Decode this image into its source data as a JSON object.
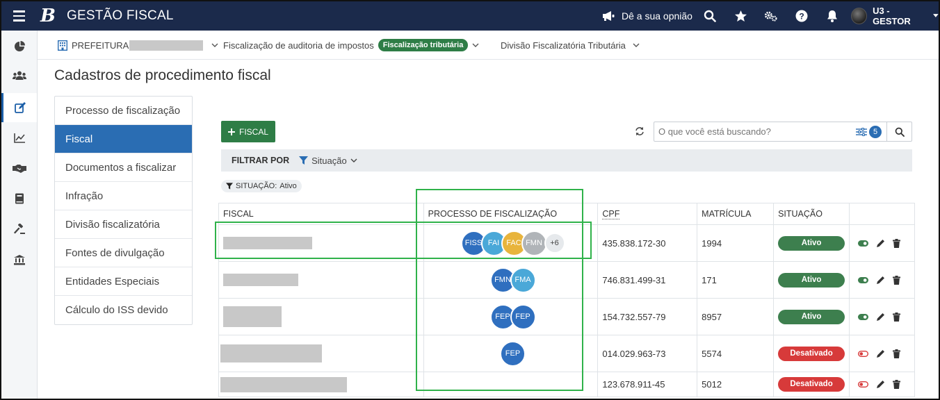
{
  "header": {
    "brand": "B",
    "app_title": "GESTÃO FISCAL",
    "feedback_label": "Dê a sua opnião",
    "user_label": "U3 - GESTOR"
  },
  "context_bar": {
    "entity_prefix": "PREFEITURA",
    "process_label": "Fiscalização de auditoria de impostos",
    "process_tag": "Fiscalização tributária",
    "division_label": "Divisão Fiscalizatória Tributária"
  },
  "page": {
    "title": "Cadastros de procedimento fiscal"
  },
  "side_menu": {
    "items": [
      "Processo de fiscalização",
      "Fiscal",
      "Documentos a fiscalizar",
      "Infração",
      "Divisão fiscalizatória",
      "Fontes de divulgação",
      "Entidades Especiais",
      "Cálculo do ISS devido"
    ],
    "active_index": 1
  },
  "toolbar": {
    "add_label": "FISCAL",
    "search_placeholder": "O que você está buscando?",
    "filter_count": "5",
    "filter_by_label": "FILTRAR POR",
    "filter_field": "Situação",
    "active_chip_key": "SITUAÇÃO:",
    "active_chip_value": "Ativo"
  },
  "table": {
    "columns": [
      "FISCAL",
      "PROCESSO DE FISCALIZAÇÃO",
      "CPF",
      "MATRÍCULA",
      "SITUAÇÃO"
    ],
    "rows": [
      {
        "cpf": "435.838.172-30",
        "matricula": "1994",
        "situacao": "Ativo",
        "processes": [
          "FISS",
          "FAI",
          "FAC",
          "FMN"
        ],
        "more": "+6"
      },
      {
        "cpf": "746.831.499-31",
        "matricula": "171",
        "situacao": "Ativo",
        "processes": [
          "FMN",
          "FMA"
        ],
        "more": ""
      },
      {
        "cpf": "154.732.557-79",
        "matricula": "8957",
        "situacao": "Ativo",
        "processes": [
          "FEP",
          "FEP"
        ],
        "more": ""
      },
      {
        "cpf": "014.029.963-73",
        "matricula": "5574",
        "situacao": "Desativado",
        "processes": [
          "FEP"
        ],
        "more": ""
      },
      {
        "cpf": "123.678.911-45",
        "matricula": "5012",
        "situacao": "Desativado",
        "processes": [],
        "more": ""
      }
    ]
  },
  "colors": {
    "topbar": "#1b2a4b",
    "primary_blue": "#2a6db3",
    "add_green": "#2e7d46",
    "status_active": "#3d7f4e",
    "status_inactive": "#d73a3a",
    "highlight": "#2fb24a"
  },
  "avatar_colors": {
    "FISS": "#2f6fbf",
    "FAI": "#4aa8d8",
    "FAC": "#e8b43c",
    "FMN": "#2f6fbf",
    "FMA": "#4aa8d8",
    "FEP": "#2f6fbf"
  }
}
